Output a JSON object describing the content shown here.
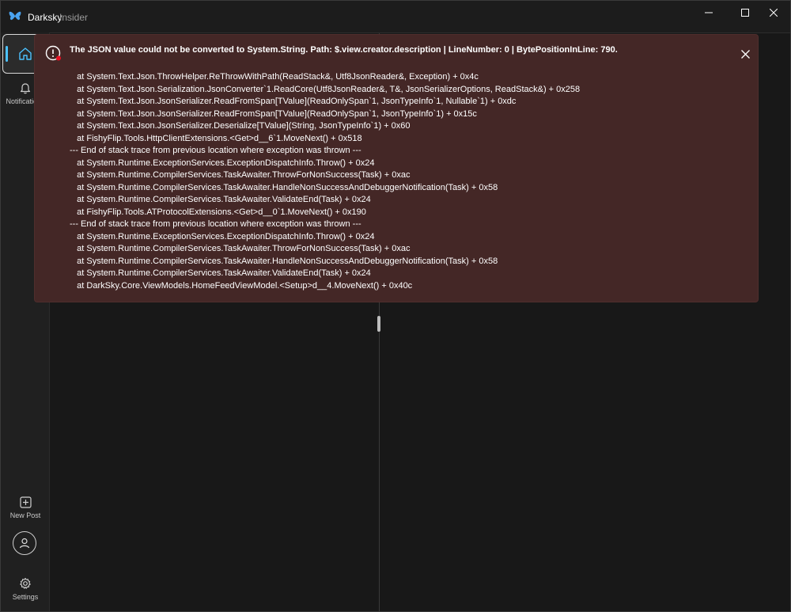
{
  "window": {
    "app_name": "Darksky",
    "app_channel": "Insider"
  },
  "sidebar": {
    "items": [
      {
        "label": "",
        "icon": "home-icon"
      },
      {
        "label": "Notifications",
        "icon": "bell-icon"
      },
      {
        "label": "New Post",
        "icon": "plus-square-icon"
      },
      {
        "label": "",
        "icon": "person-icon"
      },
      {
        "label": "Settings",
        "icon": "gear-icon"
      }
    ]
  },
  "error": {
    "title": "The JSON value could not be converted to System.String. Path: $.view.creator.description | LineNumber: 0 | BytePositionInLine: 790.",
    "stack_lines": [
      "   at System.Text.Json.ThrowHelper.ReThrowWithPath(ReadStack&, Utf8JsonReader&, Exception) + 0x4c",
      "   at System.Text.Json.Serialization.JsonConverter`1.ReadCore(Utf8JsonReader&, T&, JsonSerializerOptions, ReadStack&) + 0x258",
      "   at System.Text.Json.JsonSerializer.ReadFromSpan[TValue](ReadOnlySpan`1, JsonTypeInfo`1, Nullable`1) + 0xdc",
      "   at System.Text.Json.JsonSerializer.ReadFromSpan[TValue](ReadOnlySpan`1, JsonTypeInfo`1) + 0x15c",
      "   at System.Text.Json.JsonSerializer.Deserialize[TValue](String, JsonTypeInfo`1) + 0x60",
      "   at FishyFlip.Tools.HttpClientExtensions.<Get>d__6`1.MoveNext() + 0x518",
      "--- End of stack trace from previous location where exception was thrown ---",
      "   at System.Runtime.ExceptionServices.ExceptionDispatchInfo.Throw() + 0x24",
      "   at System.Runtime.CompilerServices.TaskAwaiter.ThrowForNonSuccess(Task) + 0xac",
      "   at System.Runtime.CompilerServices.TaskAwaiter.HandleNonSuccessAndDebuggerNotification(Task) + 0x58",
      "   at System.Runtime.CompilerServices.TaskAwaiter.ValidateEnd(Task) + 0x24",
      "   at FishyFlip.Tools.ATProtocolExtensions.<Get>d__0`1.MoveNext() + 0x190",
      "--- End of stack trace from previous location where exception was thrown ---",
      "   at System.Runtime.ExceptionServices.ExceptionDispatchInfo.Throw() + 0x24",
      "   at System.Runtime.CompilerServices.TaskAwaiter.ThrowForNonSuccess(Task) + 0xac",
      "   at System.Runtime.CompilerServices.TaskAwaiter.HandleNonSuccessAndDebuggerNotification(Task) + 0x58",
      "   at System.Runtime.CompilerServices.TaskAwaiter.ValidateEnd(Task) + 0x24",
      "   at DarkSky.Core.ViewModels.HomeFeedViewModel.<Setup>d__4.MoveNext() + 0x40c"
    ]
  },
  "colors": {
    "accent": "#4cc2ff",
    "error_background": "#442726",
    "error_badge": "#e81123"
  }
}
